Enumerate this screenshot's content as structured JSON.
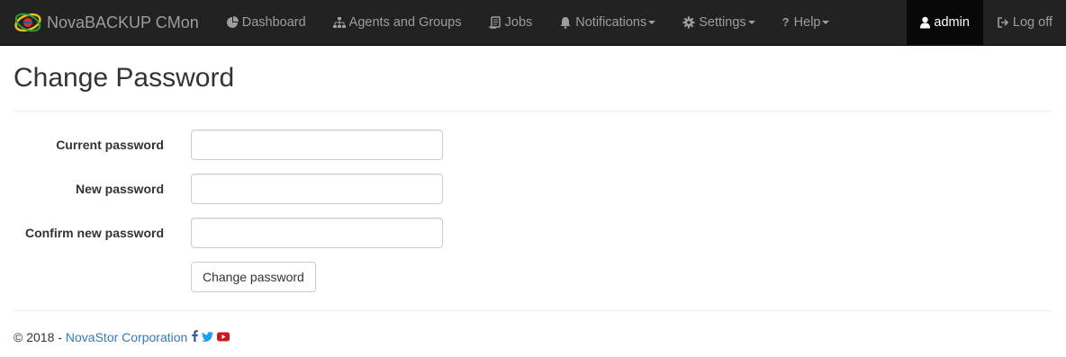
{
  "navbar": {
    "brand": "NovaBACKUP CMon",
    "items": [
      {
        "label": "Dashboard",
        "icon": "pie-chart-icon",
        "dropdown": false
      },
      {
        "label": "Agents and Groups",
        "icon": "sitemap-icon",
        "dropdown": false
      },
      {
        "label": "Jobs",
        "icon": "scroll-icon",
        "dropdown": false
      },
      {
        "label": "Notifications",
        "icon": "bell-icon",
        "dropdown": true
      },
      {
        "label": "Settings",
        "icon": "gear-icon",
        "dropdown": true
      },
      {
        "label": "Help",
        "icon": "question-icon",
        "dropdown": true
      }
    ],
    "user": {
      "label": "admin",
      "icon": "user-icon"
    },
    "logoff": {
      "label": "Log off",
      "icon": "sign-out-icon"
    }
  },
  "page": {
    "title": "Change Password"
  },
  "form": {
    "current_label": "Current password",
    "current_value": "",
    "new_label": "New password",
    "new_value": "",
    "confirm_label": "Confirm new password",
    "confirm_value": "",
    "submit_label": "Change password"
  },
  "footer": {
    "copyright": "© 2018 -",
    "company": "NovaStor Corporation",
    "social": [
      "facebook-icon",
      "twitter-icon",
      "youtube-icon"
    ]
  },
  "colors": {
    "navbar_bg": "#222222",
    "navbar_text": "#9d9d9d",
    "active_bg": "#080808",
    "link": "#337ab7",
    "facebook": "#3b5998",
    "twitter": "#1da1f2",
    "youtube": "#cc181e"
  }
}
